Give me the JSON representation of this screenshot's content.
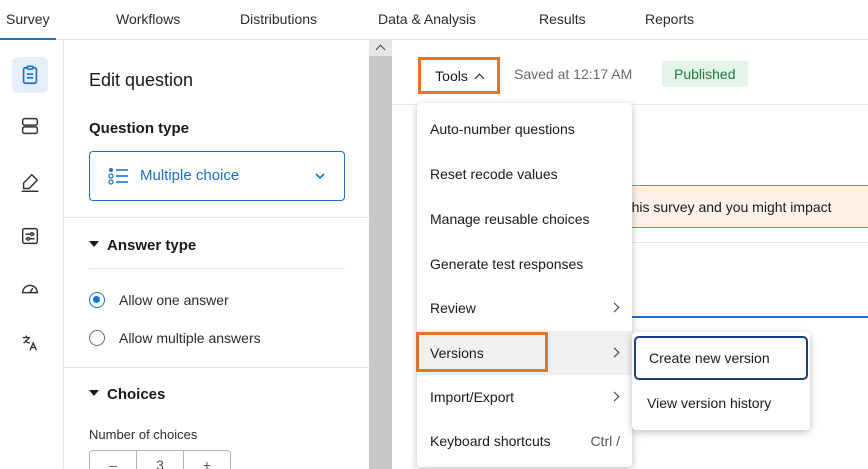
{
  "topnav": {
    "tabs": [
      {
        "label": "Survey",
        "active": true
      },
      {
        "label": "Workflows"
      },
      {
        "label": "Distributions"
      },
      {
        "label": "Data & Analysis"
      },
      {
        "label": "Results"
      },
      {
        "label": "Reports"
      }
    ]
  },
  "rail": {
    "icons": [
      "survey-clipboard-icon",
      "survey-flow-icon",
      "look-and-feel-icon",
      "survey-options-icon",
      "tools-gauge-icon",
      "translate-icon"
    ]
  },
  "panel": {
    "title": "Edit question",
    "question_type_label": "Question type",
    "question_type_value": "Multiple choice",
    "answer_type_label": "Answer type",
    "answer_options": [
      {
        "label": "Allow one answer",
        "selected": true
      },
      {
        "label": "Allow multiple answers",
        "selected": false
      }
    ],
    "choices_label": "Choices",
    "number_of_choices_label": "Number of choices",
    "stepper": {
      "minus": "–",
      "value": "3",
      "plus": "+"
    }
  },
  "toolbar": {
    "tools_label": "Tools",
    "saved_text": "Saved at 12:17 AM",
    "status_badge": "Published"
  },
  "main": {
    "warning_text": "g this survey and you might impact"
  },
  "tools_menu": {
    "items": [
      {
        "label": "Auto-number questions"
      },
      {
        "label": "Reset recode values"
      },
      {
        "label": "Manage reusable choices"
      },
      {
        "label": "Generate test responses"
      },
      {
        "label": "Review",
        "submenu": true
      },
      {
        "label": "Versions",
        "submenu": true,
        "highlighted": true
      },
      {
        "label": "Import/Export",
        "submenu": true
      },
      {
        "label": "Keyboard shortcuts",
        "shortcut": "Ctrl /"
      }
    ]
  },
  "versions_submenu": {
    "items": [
      {
        "label": "Create new version",
        "focused": true
      },
      {
        "label": "View version history"
      }
    ]
  },
  "colors": {
    "accent": "#1a6fd1",
    "highlight_outline": "#e8722c",
    "published_bg": "#e3f4e8",
    "published_text": "#1f7a3a"
  }
}
